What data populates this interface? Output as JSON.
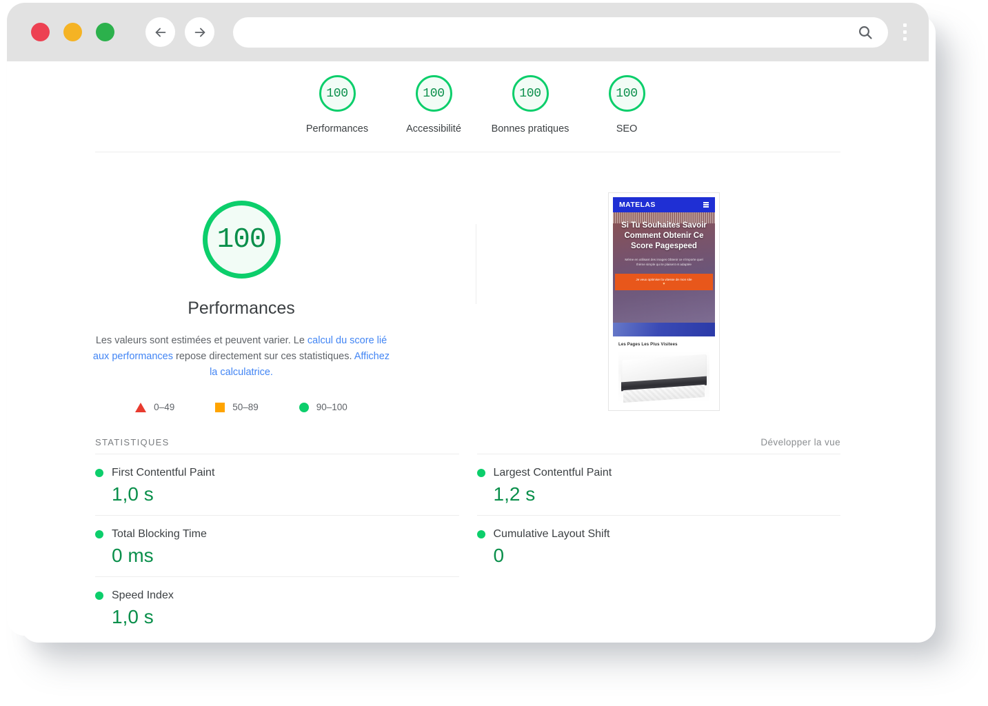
{
  "browser": {
    "traffic_lights": [
      "close",
      "minimize",
      "maximize"
    ],
    "back_label": "Retour",
    "forward_label": "Suivant",
    "address_value": "",
    "address_placeholder": "",
    "search_icon": "search-icon",
    "menu_icon": "kebab-menu-icon"
  },
  "gauges": [
    {
      "score": "100",
      "label": "Performances"
    },
    {
      "score": "100",
      "label": "Accessibilité"
    },
    {
      "score": "100",
      "label": "Bonnes pratiques"
    },
    {
      "score": "100",
      "label": "SEO"
    }
  ],
  "hero": {
    "score": "100",
    "title": "Performances",
    "desc_part1": "Les valeurs sont estimées et peuvent varier. Le ",
    "link1": "calcul du score lié aux performances",
    "desc_part2": " repose directement sur ces statistiques. ",
    "link2": "Affichez la calculatrice.",
    "legend": [
      {
        "shape": "triangle",
        "range": "0–49",
        "color": "#e83b2f"
      },
      {
        "shape": "square",
        "range": "50–89",
        "color": "#ffa400"
      },
      {
        "shape": "circle",
        "range": "90–100",
        "color": "#0cce6b"
      }
    ]
  },
  "thumbnail": {
    "logo": "MATELAS",
    "menu_icon": "hamburger-icon",
    "headline": "Si Tu Souhaites Savoir Comment Obtenir Ce Score Pagespeed",
    "subtext": "Méme en utilisant des images Obtenir ce n'importe quel thème simple qui te plaisent et adaptée",
    "cta_text": "Je veux optimiser la vitesse de mon site",
    "cta_arrow": "▼",
    "section_title": "Les Pages Les Plus Visitees",
    "photo_alt": "mattress-photo"
  },
  "stats": {
    "title": "STATISTIQUES",
    "expand_label": "Développer la vue",
    "left_column": [
      {
        "name": "First Contentful Paint",
        "value": "1,0 s",
        "status_color": "#0cce6b"
      },
      {
        "name": "Total Blocking Time",
        "value": "0 ms",
        "status_color": "#0cce6b"
      },
      {
        "name": "Speed Index",
        "value": "1,0 s",
        "status_color": "#0cce6b"
      }
    ],
    "right_column": [
      {
        "name": "Largest Contentful Paint",
        "value": "1,2 s",
        "status_color": "#0cce6b"
      },
      {
        "name": "Cumulative Layout Shift",
        "value": "0",
        "status_color": "#0cce6b"
      }
    ]
  },
  "colors": {
    "pass_green": "#0cce6b",
    "score_text_green": "#0a8f4b",
    "average_orange": "#ffa400",
    "fail_red": "#e83b2f",
    "link_blue": "#4285f4",
    "chrome_gray": "#e2e2e2"
  }
}
